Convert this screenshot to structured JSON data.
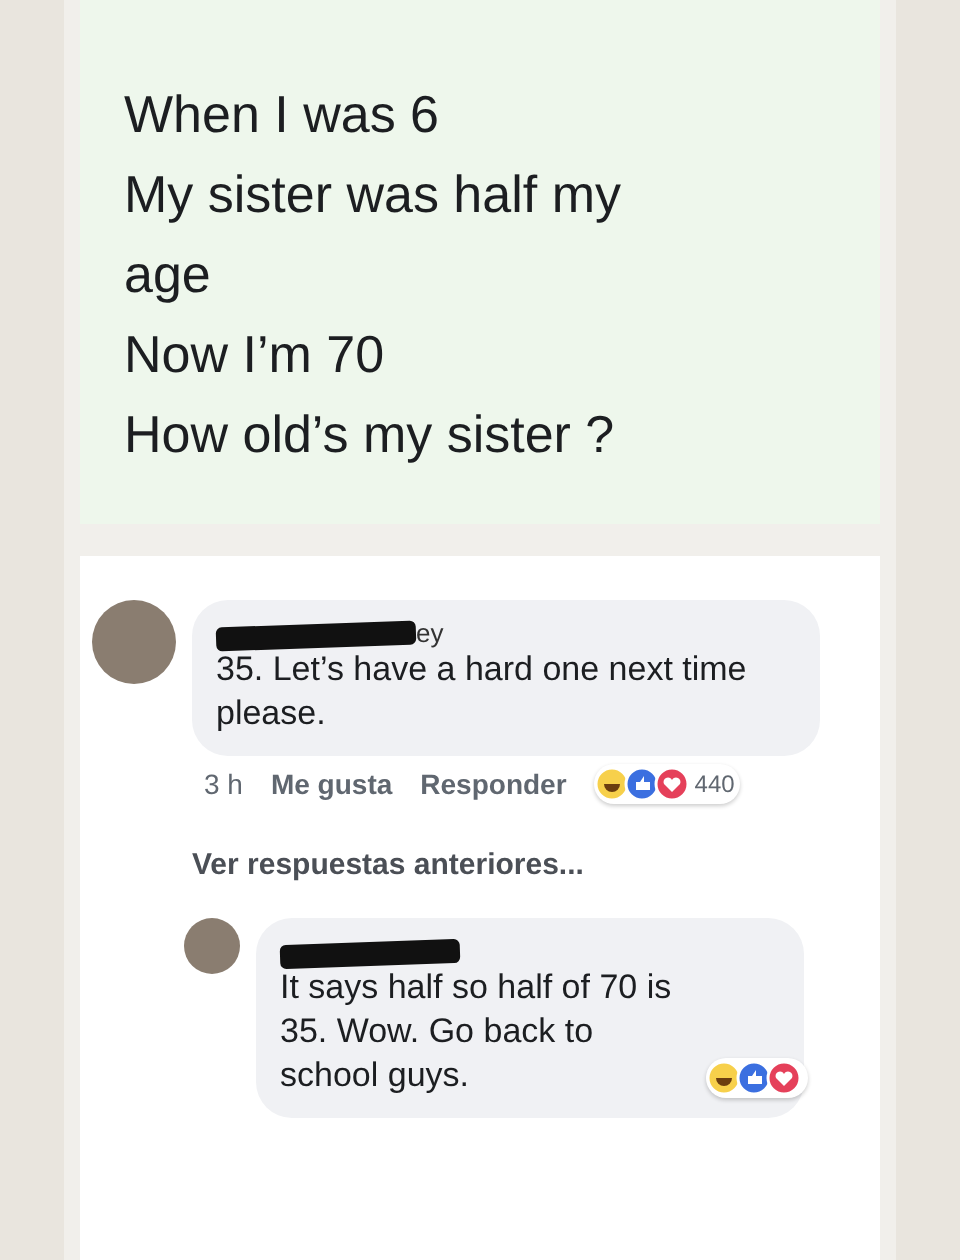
{
  "post": {
    "lines": [
      "When I was 6",
      "My sister was half my",
      "age",
      "Now I’m 70",
      "How old’s my sister ?"
    ]
  },
  "comments": [
    {
      "name_fragment": "ey",
      "text": "35. Let’s have a hard one next time please.",
      "time": "3 h",
      "like": "Me gusta",
      "reply": "Responder",
      "reaction_count": "440"
    }
  ],
  "more_replies": "Ver respuestas anteriores...",
  "replies": [
    {
      "text": "It says half so half of 70 is 35. Wow. Go back to school guys."
    }
  ]
}
